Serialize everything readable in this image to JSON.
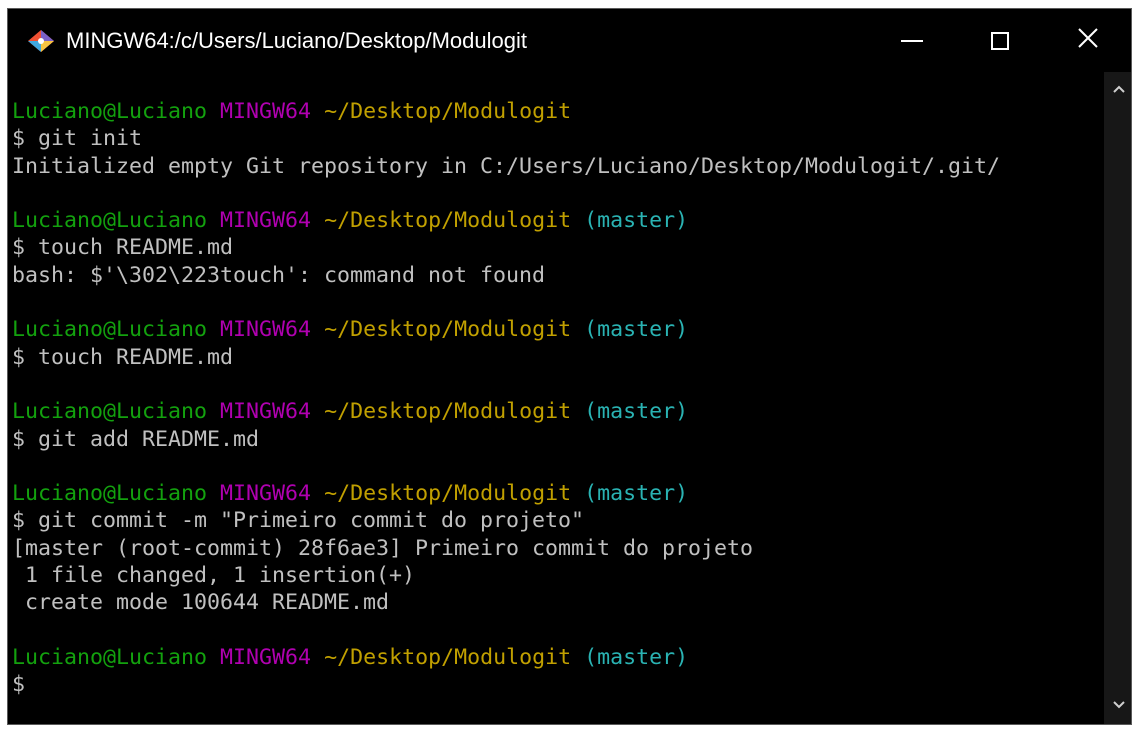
{
  "window": {
    "title": "MINGW64:/c/Users/Luciano/Desktop/Modulogit",
    "app_icon": "git-bash-icon",
    "controls": {
      "minimize_icon": "minimize-icon",
      "maximize_icon": "maximize-icon",
      "close_icon": "close-icon",
      "close_glyph": "✕"
    }
  },
  "colors": {
    "user": "#13a10e",
    "host": "#b000b0",
    "path": "#c1a000",
    "branch": "#2ab3b3",
    "text": "#c0c0c0",
    "background": "#000000"
  },
  "terminal": {
    "lines": [
      {
        "segments": [
          {
            "type": "user",
            "text": "Luciano@Luciano"
          },
          {
            "type": "plain",
            "text": " "
          },
          {
            "type": "host",
            "text": "MINGW64"
          },
          {
            "type": "plain",
            "text": " "
          },
          {
            "type": "path",
            "text": "~/Desktop/Modulogit"
          }
        ]
      },
      {
        "segments": [
          {
            "type": "plain",
            "text": "$ git init"
          }
        ]
      },
      {
        "segments": [
          {
            "type": "plain",
            "text": "Initialized empty Git repository in C:/Users/Luciano/Desktop/Modulogit/.git/"
          }
        ]
      },
      {
        "segments": [
          {
            "type": "plain",
            "text": ""
          }
        ]
      },
      {
        "segments": [
          {
            "type": "user",
            "text": "Luciano@Luciano"
          },
          {
            "type": "plain",
            "text": " "
          },
          {
            "type": "host",
            "text": "MINGW64"
          },
          {
            "type": "plain",
            "text": " "
          },
          {
            "type": "path",
            "text": "~/Desktop/Modulogit"
          },
          {
            "type": "plain",
            "text": " "
          },
          {
            "type": "branch",
            "text": "(master)"
          }
        ]
      },
      {
        "segments": [
          {
            "type": "plain",
            "text": "$ touch README.md"
          }
        ]
      },
      {
        "segments": [
          {
            "type": "plain",
            "text": "bash: $'\\302\\223touch': command not found"
          }
        ]
      },
      {
        "segments": [
          {
            "type": "plain",
            "text": ""
          }
        ]
      },
      {
        "segments": [
          {
            "type": "user",
            "text": "Luciano@Luciano"
          },
          {
            "type": "plain",
            "text": " "
          },
          {
            "type": "host",
            "text": "MINGW64"
          },
          {
            "type": "plain",
            "text": " "
          },
          {
            "type": "path",
            "text": "~/Desktop/Modulogit"
          },
          {
            "type": "plain",
            "text": " "
          },
          {
            "type": "branch",
            "text": "(master)"
          }
        ]
      },
      {
        "segments": [
          {
            "type": "plain",
            "text": "$ touch README.md"
          }
        ]
      },
      {
        "segments": [
          {
            "type": "plain",
            "text": ""
          }
        ]
      },
      {
        "segments": [
          {
            "type": "user",
            "text": "Luciano@Luciano"
          },
          {
            "type": "plain",
            "text": " "
          },
          {
            "type": "host",
            "text": "MINGW64"
          },
          {
            "type": "plain",
            "text": " "
          },
          {
            "type": "path",
            "text": "~/Desktop/Modulogit"
          },
          {
            "type": "plain",
            "text": " "
          },
          {
            "type": "branch",
            "text": "(master)"
          }
        ]
      },
      {
        "segments": [
          {
            "type": "plain",
            "text": "$ git add README.md"
          }
        ]
      },
      {
        "segments": [
          {
            "type": "plain",
            "text": ""
          }
        ]
      },
      {
        "segments": [
          {
            "type": "user",
            "text": "Luciano@Luciano"
          },
          {
            "type": "plain",
            "text": " "
          },
          {
            "type": "host",
            "text": "MINGW64"
          },
          {
            "type": "plain",
            "text": " "
          },
          {
            "type": "path",
            "text": "~/Desktop/Modulogit"
          },
          {
            "type": "plain",
            "text": " "
          },
          {
            "type": "branch",
            "text": "(master)"
          }
        ]
      },
      {
        "segments": [
          {
            "type": "plain",
            "text": "$ git commit -m \"Primeiro commit do projeto\""
          }
        ]
      },
      {
        "segments": [
          {
            "type": "plain",
            "text": "[master (root-commit) 28f6ae3] Primeiro commit do projeto"
          }
        ]
      },
      {
        "segments": [
          {
            "type": "plain",
            "text": " 1 file changed, 1 insertion(+)"
          }
        ]
      },
      {
        "segments": [
          {
            "type": "plain",
            "text": " create mode 100644 README.md"
          }
        ]
      },
      {
        "segments": [
          {
            "type": "plain",
            "text": ""
          }
        ]
      },
      {
        "segments": [
          {
            "type": "user",
            "text": "Luciano@Luciano"
          },
          {
            "type": "plain",
            "text": " "
          },
          {
            "type": "host",
            "text": "MINGW64"
          },
          {
            "type": "plain",
            "text": " "
          },
          {
            "type": "path",
            "text": "~/Desktop/Modulogit"
          },
          {
            "type": "plain",
            "text": " "
          },
          {
            "type": "branch",
            "text": "(master)"
          }
        ]
      },
      {
        "segments": [
          {
            "type": "plain",
            "text": "$"
          }
        ]
      }
    ]
  },
  "scrollbar": {
    "up_icon": "chevron-up-icon",
    "down_icon": "chevron-down-icon"
  }
}
